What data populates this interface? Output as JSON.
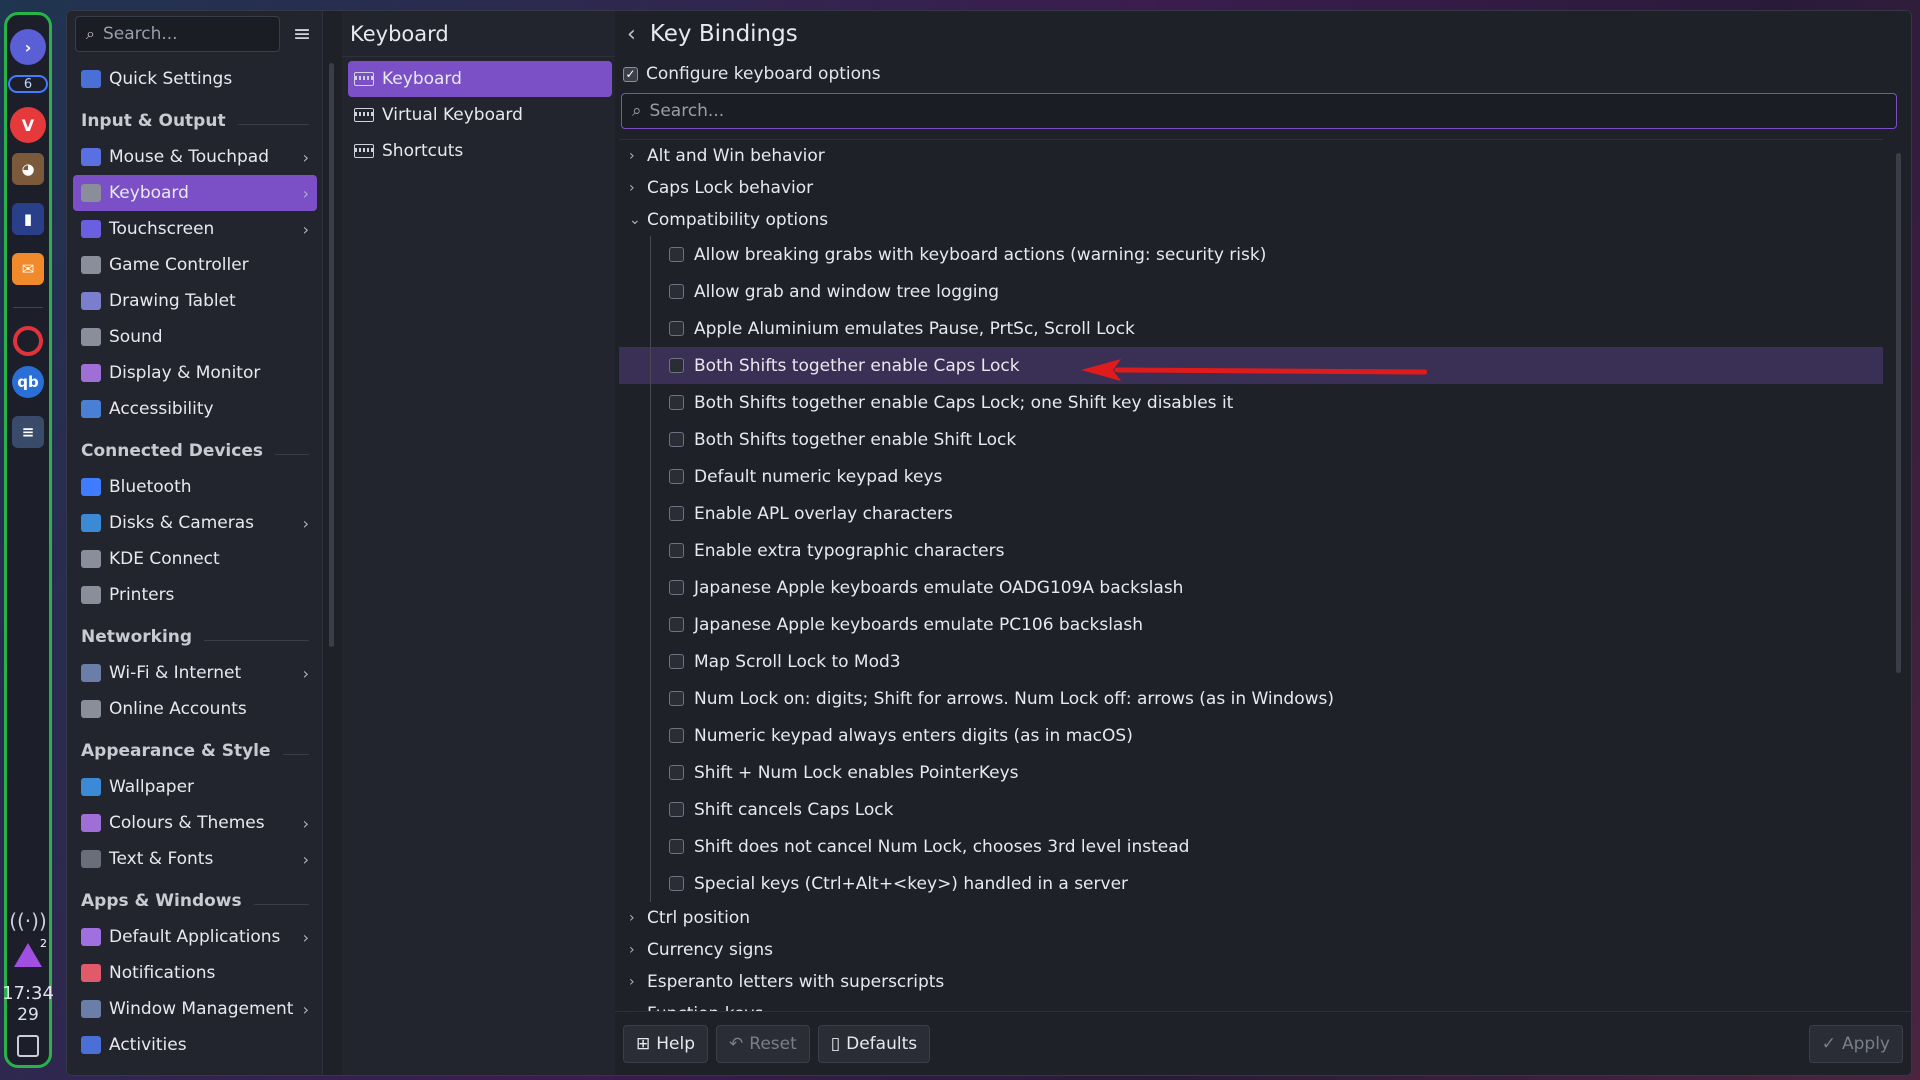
{
  "dock": {
    "workspace_badge": "6",
    "clock_time": "17:34",
    "clock_date": "29",
    "notification_count": "2"
  },
  "sidebar": {
    "search_placeholder": "Search...",
    "items": [
      {
        "type": "item",
        "label": "Quick Settings",
        "icon": "quick-settings-icon",
        "color": "#4a6fd6",
        "chevron": false
      },
      {
        "type": "header",
        "label": "Input & Output"
      },
      {
        "type": "item",
        "label": "Mouse & Touchpad",
        "icon": "mouse-icon",
        "color": "#5a6fe0",
        "chevron": true
      },
      {
        "type": "item",
        "label": "Keyboard",
        "icon": "keyboard-icon",
        "color": "#8a8e9a",
        "chevron": true,
        "selected": true
      },
      {
        "type": "item",
        "label": "Touchscreen",
        "icon": "touchscreen-icon",
        "color": "#6a5fe0",
        "chevron": true
      },
      {
        "type": "item",
        "label": "Game Controller",
        "icon": "gamepad-icon",
        "color": "#8a8e9a",
        "chevron": false
      },
      {
        "type": "item",
        "label": "Drawing Tablet",
        "icon": "tablet-icon",
        "color": "#7a7ecc",
        "chevron": false
      },
      {
        "type": "item",
        "label": "Sound",
        "icon": "speaker-icon",
        "color": "#8a8e9a",
        "chevron": false
      },
      {
        "type": "item",
        "label": "Display & Monitor",
        "icon": "display-icon",
        "color": "#a06fd6",
        "chevron": false
      },
      {
        "type": "item",
        "label": "Accessibility",
        "icon": "accessibility-icon",
        "color": "#4a7fd6",
        "chevron": false
      },
      {
        "type": "header",
        "label": "Connected Devices"
      },
      {
        "type": "item",
        "label": "Bluetooth",
        "icon": "bluetooth-icon",
        "color": "#3f7cff",
        "chevron": false
      },
      {
        "type": "item",
        "label": "Disks & Cameras",
        "icon": "disk-icon",
        "color": "#3a8ad6",
        "chevron": true
      },
      {
        "type": "item",
        "label": "KDE Connect",
        "icon": "phone-icon",
        "color": "#8a8e9a",
        "chevron": false
      },
      {
        "type": "item",
        "label": "Printers",
        "icon": "printer-icon",
        "color": "#8a8e9a",
        "chevron": false
      },
      {
        "type": "header",
        "label": "Networking"
      },
      {
        "type": "item",
        "label": "Wi-Fi & Internet",
        "icon": "network-icon",
        "color": "#6a7ea8",
        "chevron": true
      },
      {
        "type": "item",
        "label": "Online Accounts",
        "icon": "accounts-icon",
        "color": "#8a8e9a",
        "chevron": false
      },
      {
        "type": "header",
        "label": "Appearance & Style"
      },
      {
        "type": "item",
        "label": "Wallpaper",
        "icon": "wallpaper-icon",
        "color": "#3a8ad6",
        "chevron": false
      },
      {
        "type": "item",
        "label": "Colours & Themes",
        "icon": "palette-icon",
        "color": "#a06fd6",
        "chevron": true
      },
      {
        "type": "item",
        "label": "Text & Fonts",
        "icon": "font-icon",
        "color": "#6a6e7a",
        "chevron": true
      },
      {
        "type": "header",
        "label": "Apps & Windows"
      },
      {
        "type": "item",
        "label": "Default Applications",
        "icon": "star-icon",
        "color": "#a06fe0",
        "chevron": true
      },
      {
        "type": "item",
        "label": "Notifications",
        "icon": "bell-icon",
        "color": "#e05a6a",
        "chevron": false
      },
      {
        "type": "item",
        "label": "Window Management",
        "icon": "window-icon",
        "color": "#6a7ea8",
        "chevron": true
      },
      {
        "type": "item",
        "label": "Activities",
        "icon": "activities-icon",
        "color": "#4a6fd6",
        "chevron": false
      }
    ]
  },
  "subpanel": {
    "title": "Keyboard",
    "items": [
      {
        "label": "Keyboard",
        "selected": true
      },
      {
        "label": "Virtual Keyboard",
        "selected": false
      },
      {
        "label": "Shortcuts",
        "selected": false
      }
    ]
  },
  "main": {
    "title": "Key Bindings",
    "configure_label": "Configure keyboard options",
    "configure_checked": "✓",
    "search_placeholder": "Search...",
    "groups_top": [
      {
        "label": "Alt and Win behavior",
        "arrow": "›"
      },
      {
        "label": "Caps Lock behavior",
        "arrow": "›"
      },
      {
        "label": "Compatibility options",
        "arrow": "⌄"
      }
    ],
    "options": [
      "Allow breaking grabs with keyboard actions (warning: security risk)",
      "Allow grab and window tree logging",
      "Apple Aluminium emulates Pause, PrtSc, Scroll Lock",
      "Both Shifts together enable Caps Lock",
      "Both Shifts together enable Caps Lock; one Shift key disables it",
      "Both Shifts together enable Shift Lock",
      "Default numeric keypad keys",
      "Enable APL overlay characters",
      "Enable extra typographic characters",
      "Japanese Apple keyboards emulate OADG109A backslash",
      "Japanese Apple keyboards emulate PC106 backslash",
      "Map Scroll Lock to Mod3",
      "Num Lock on: digits; Shift for arrows. Num Lock off: arrows (as in Windows)",
      "Numeric keypad always enters digits (as in macOS)",
      "Shift + Num Lock enables PointerKeys",
      "Shift cancels Caps Lock",
      "Shift does not cancel Num Lock, chooses 3rd level instead",
      "Special keys (Ctrl+Alt+<key>) handled in a server"
    ],
    "highlighted_index": 3,
    "groups_bottom": [
      {
        "label": "Ctrl position",
        "arrow": "›"
      },
      {
        "label": "Currency signs",
        "arrow": "›"
      },
      {
        "label": "Esperanto letters with superscripts",
        "arrow": "›"
      },
      {
        "label": "Function keys",
        "arrow": "›"
      }
    ]
  },
  "footer": {
    "help_label": "Help",
    "reset_label": "Reset",
    "defaults_label": "Defaults",
    "apply_label": "Apply"
  },
  "colors": {
    "accent": "#7b4fc6",
    "highlight_row": "#3a2f55",
    "annotation_arrow": "#e01b1b",
    "dock_border": "#27b24a"
  }
}
